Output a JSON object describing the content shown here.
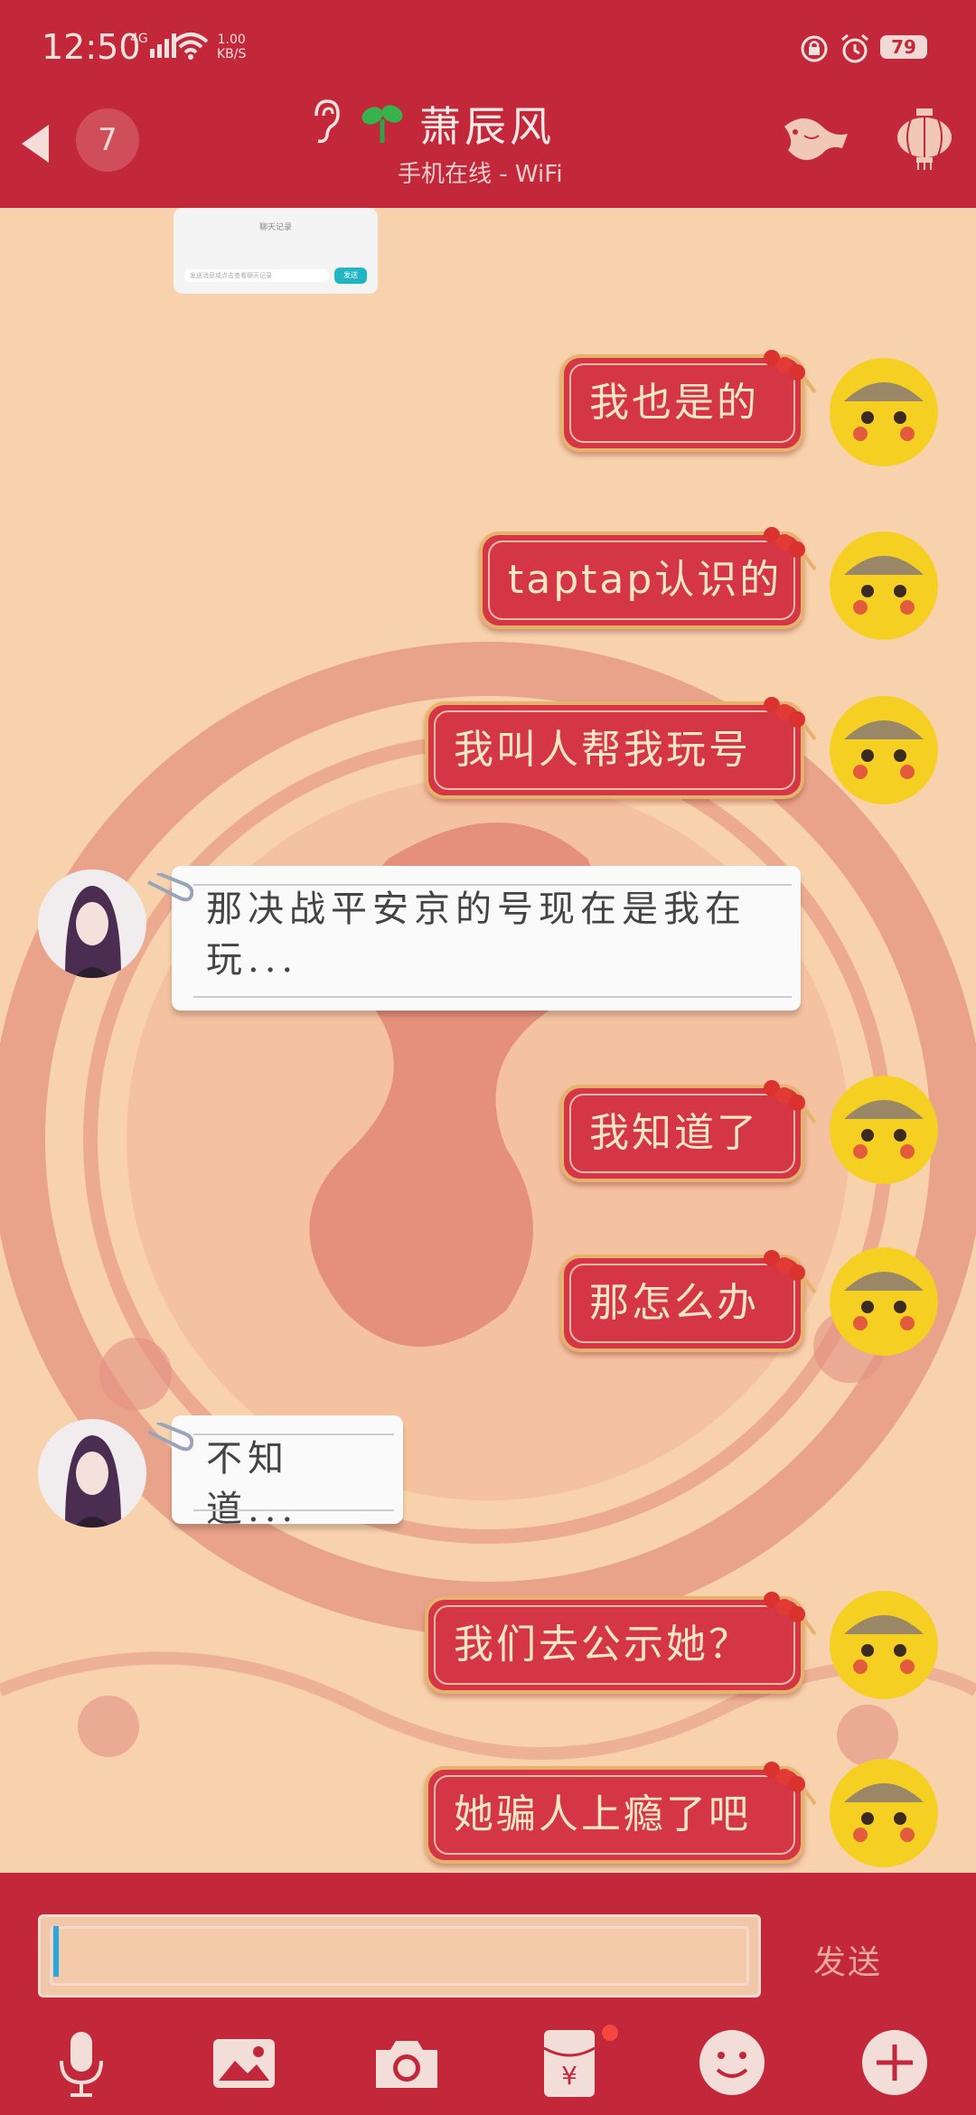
{
  "status_bar": {
    "time": "12:50",
    "network": "4G",
    "speed_value": "1.00",
    "speed_unit": "KB/S",
    "battery": "79"
  },
  "header": {
    "unread_count": "7",
    "contact_name": "萧辰风",
    "contact_status": "手机在线 - WiFi"
  },
  "preview": {
    "title": "聊天记录",
    "input_placeholder": "发送消息或点击查看聊天记录",
    "button": "发送"
  },
  "messages": [
    {
      "side": "right",
      "text": "我也是的"
    },
    {
      "side": "right",
      "text": "taptap认识的"
    },
    {
      "side": "right",
      "text": "我叫人帮我玩号"
    },
    {
      "side": "left",
      "text": "那决战平安京的号现在是我在玩..."
    },
    {
      "side": "right",
      "text": "我知道了"
    },
    {
      "side": "right",
      "text": "那怎么办"
    },
    {
      "side": "left",
      "text": "不知道..."
    },
    {
      "side": "right",
      "text": "我们去公示她？"
    },
    {
      "side": "right",
      "text": "她骗人上瘾了吧"
    }
  ],
  "input": {
    "value": "",
    "send_label": "发送"
  },
  "toolbar": [
    "microphone-icon",
    "image-icon",
    "camera-icon",
    "red-packet-icon",
    "emoji-icon",
    "plus-icon"
  ],
  "colors": {
    "theme_red": "#c2273a",
    "bubble_red": "#d43646",
    "bubble_text": "#fbe7c8",
    "background": "#f8d2ad"
  }
}
